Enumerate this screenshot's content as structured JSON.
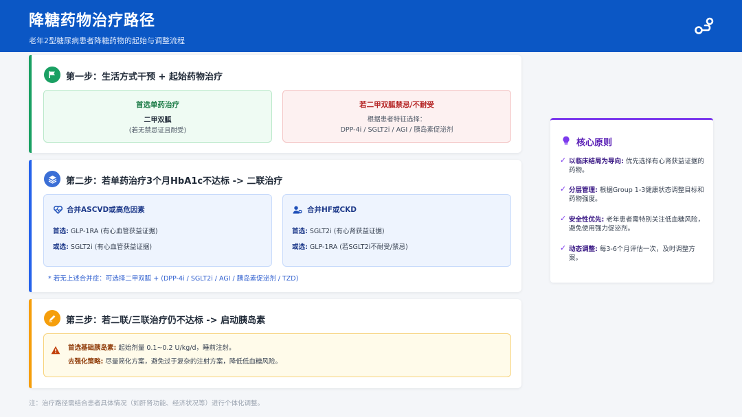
{
  "header": {
    "title": "降糖药物治疗路径",
    "subtitle": "老年2型糖尿病患者降糖药物的起始与调整流程",
    "icon": "route-icon"
  },
  "step1": {
    "title": "第一步：生活方式干预 + 起始药物治疗",
    "icon": "flag-icon",
    "color": "#1aa063",
    "preferred": {
      "heading": "首选单药治疗",
      "drug": "二甲双胍",
      "note": "(若无禁忌证且耐受)"
    },
    "contraindicated": {
      "heading": "若二甲双胍禁忌/不耐受",
      "line1": "根据患者特征选择：",
      "line2": "DPP-4i / SGLT2i / AGI / 胰岛素促泌剂"
    }
  },
  "step2": {
    "title": "第二步：若单药治疗3个月HbA1c不达标 -> 二联治疗",
    "icon": "layers-icon",
    "color": "#2563eb",
    "ascvd": {
      "heading": "合并ASCVD或高危因素",
      "icon": "heartbeat-icon",
      "first_label": "首选:",
      "first_text": "GLP-1RA (有心血管获益证据)",
      "alt_label": "或选:",
      "alt_text": "SGLT2i (有心血管获益证据)"
    },
    "hf_ckd": {
      "heading": "合并HF或CKD",
      "icon": "user-medical-icon",
      "first_label": "首选:",
      "first_text": "SGLT2i (有心肾获益证据)",
      "alt_label": "或选:",
      "alt_text": "GLP-1RA (若SGLT2i不耐受/禁忌)"
    },
    "footnote": "* 若无上述合并症：可选择二甲双胍 + (DPP-4i / SGLT2i / AGI / 胰岛素促泌剂 / TZD)"
  },
  "step3": {
    "title": "第三步：若二联/三联治疗仍不达标 -> 启动胰岛素",
    "icon": "pen-icon",
    "color": "#f59e0b",
    "basal_label": "首选基础胰岛素:",
    "basal_text": "起始剂量 0.1~0.2 U/kg/d，睡前注射。",
    "intensify_label": "去强化策略:",
    "intensify_text": "尽量简化方案，避免过于复杂的注射方案，降低低血糖风险。",
    "warning_icon": "warning-icon"
  },
  "footer_note": "注：治疗路径需结合患者具体情况（如肝肾功能、经济状况等）进行个体化调整。",
  "principles": {
    "title": "核心原则",
    "icon": "lightbulb-icon",
    "accent": "#7c3aed",
    "items": [
      {
        "label": "以临床结局为导向:",
        "text": "优先选择有心肾获益证据的药物。"
      },
      {
        "label": "分层管理:",
        "text": "根据Group 1-3健康状态调整目标和药物强度。"
      },
      {
        "label": "安全性优先:",
        "text": "老年患者需特别关注低血糖风险，避免使用强力促泌剂。"
      },
      {
        "label": "动态调整:",
        "text": "每3-6个月评估一次，及时调整方案。"
      }
    ]
  }
}
